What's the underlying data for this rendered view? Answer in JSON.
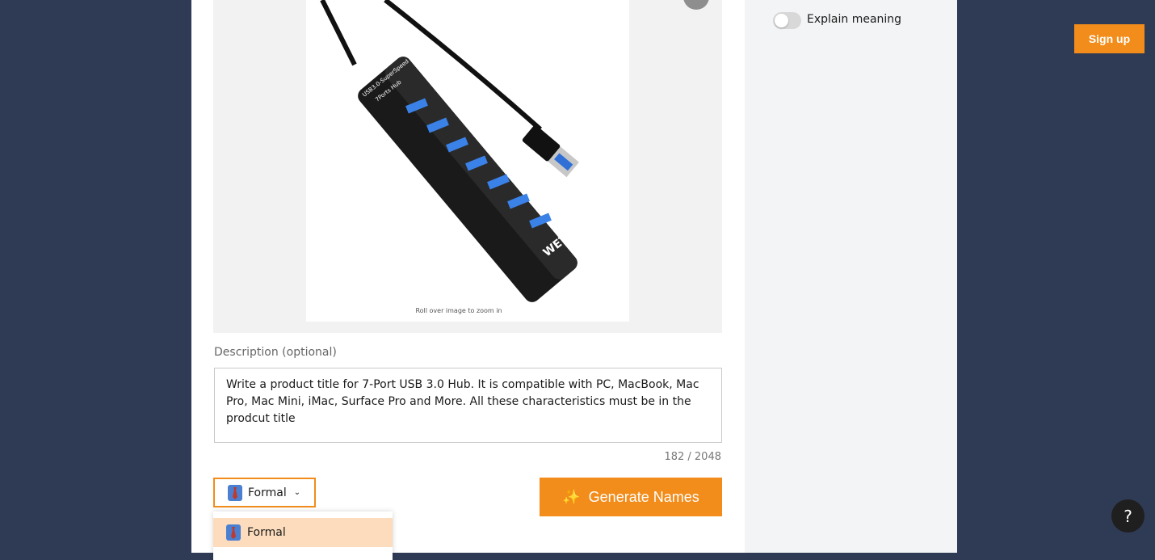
{
  "image_upload": {
    "zoom_hint": "Roll over image to zoom in",
    "product_label_top": "USB3.0-SuperSpeed",
    "product_label_sub": "7Ports Hub",
    "brand_mark": "WETTO"
  },
  "description": {
    "label": "Description (optional)",
    "value": "Write a product title for 7-Port USB 3.0 Hub. It is compatible with PC, MacBook, Mac Pro, Mac Mini, iMac, Surface Pro and More. All these characteristics must be in the prodcut title",
    "char_count": "182 / 2048"
  },
  "tone": {
    "selected": "Formal",
    "options": [
      "Formal"
    ],
    "icon": "necktie-icon"
  },
  "generate": {
    "label": "Generate Names",
    "icon": "sparkles-icon"
  },
  "settings": {
    "explain_meaning_label": "Explain meaning",
    "explain_meaning_on": false
  },
  "header": {
    "signup_label": "Sign up"
  },
  "help": {
    "label": "?"
  },
  "colors": {
    "accent": "#f28c1a",
    "background": "#2f3b55",
    "option_highlight": "#fcdcbc"
  }
}
